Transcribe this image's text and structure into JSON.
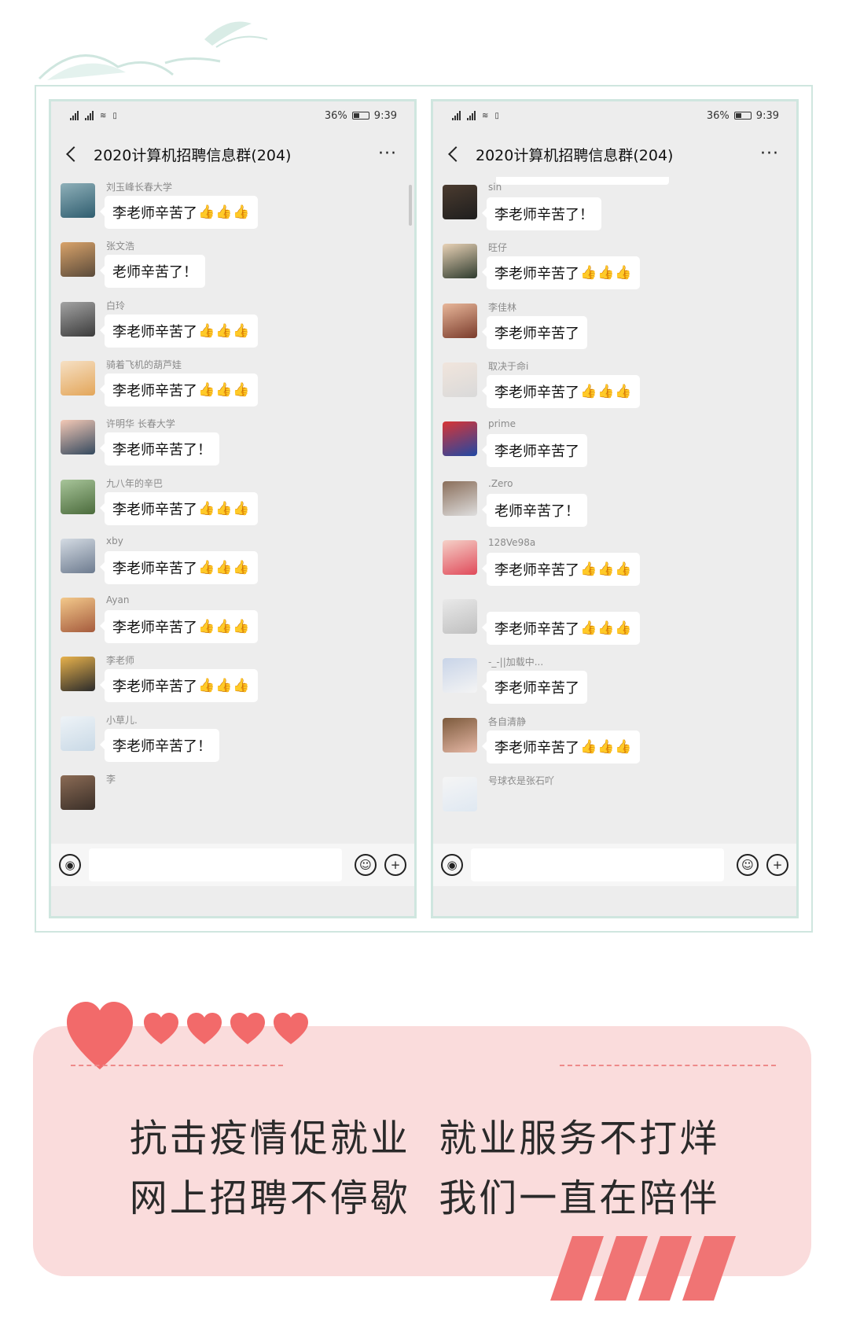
{
  "colors": {
    "accent_green": "#cfe6df",
    "pink_card": "#fadcdc",
    "heart": "#f26a6a",
    "stripe": "#f07474"
  },
  "phones": [
    {
      "status": {
        "time": "9:39",
        "battery": "36%",
        "signal_left": "36",
        "signal_right": "4G"
      },
      "title": "2020计算机招聘信息群(204)",
      "messages": [
        {
          "name": "刘玉峰长春大学",
          "text": "李老师辛苦了",
          "thumbs": 3
        },
        {
          "name": "张文浩",
          "text": "老师辛苦了！",
          "thumbs": 0
        },
        {
          "name": "白玲",
          "text": "李老师辛苦了",
          "thumbs": 3
        },
        {
          "name": "骑着飞机的葫芦娃",
          "text": "李老师辛苦了",
          "thumbs": 3
        },
        {
          "name": "许明华 长春大学",
          "text": "李老师辛苦了！",
          "thumbs": 0
        },
        {
          "name": "九八年的辛巴",
          "text": "李老师辛苦了",
          "thumbs": 3
        },
        {
          "name": "xby",
          "text": "李老师辛苦了",
          "thumbs": 3
        },
        {
          "name": "Ayan",
          "text": "李老师辛苦了",
          "thumbs": 3
        },
        {
          "name": "李老师",
          "text": "李老师辛苦了",
          "thumbs": 3
        },
        {
          "name": "小草儿.",
          "text": "李老师辛苦了！",
          "thumbs": 0
        },
        {
          "name": "李",
          "text": "",
          "thumbs": 0
        }
      ]
    },
    {
      "status": {
        "time": "9:39",
        "battery": "36%",
        "signal_left": "36",
        "signal_right": "4G"
      },
      "title": "2020计算机招聘信息群(204)",
      "messages": [
        {
          "name": "sin",
          "text": "李老师辛苦了！",
          "thumbs": 0
        },
        {
          "name": "旺仔",
          "text": "李老师辛苦了",
          "thumbs": 3
        },
        {
          "name": "李佳林",
          "text": "李老师辛苦了",
          "thumbs": 0
        },
        {
          "name": "取决于命i",
          "text": "李老师辛苦了",
          "thumbs": 3
        },
        {
          "name": "prime",
          "text": "李老师辛苦了",
          "thumbs": 0
        },
        {
          "name": ".Zero",
          "text": "老师辛苦了！",
          "thumbs": 0
        },
        {
          "name": "128Ve98a",
          "text": "李老师辛苦了",
          "thumbs": 3
        },
        {
          "name": "",
          "text": "李老师辛苦了",
          "thumbs": 3
        },
        {
          "name": "-_-||加载中...",
          "text": "李老师辛苦了",
          "thumbs": 0
        },
        {
          "name": "各自清静",
          "text": "李老师辛苦了",
          "thumbs": 3
        },
        {
          "name": "号球衣是张石吖",
          "text": "",
          "thumbs": 0
        }
      ]
    }
  ],
  "slogan": {
    "line1": "抗击疫情促就业  就业服务不打烊",
    "line2": "网上招聘不停歇  我们一直在陪伴"
  }
}
